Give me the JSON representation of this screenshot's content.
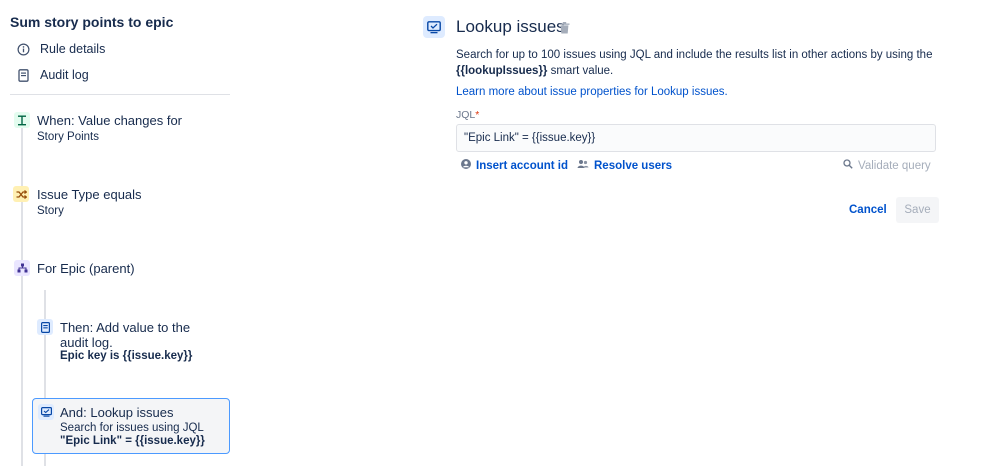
{
  "sidebar": {
    "rule_title": "Sum story points to epic",
    "menu": [
      {
        "label": "Rule details",
        "icon": "info-icon"
      },
      {
        "label": "Audit log",
        "icon": "document-icon"
      }
    ],
    "steps": {
      "trigger": {
        "title": "When: Value changes for",
        "sub": "Story Points",
        "icon": "trigger-icon",
        "color": "#E3FCEF"
      },
      "condition": {
        "title": "Issue Type equals",
        "sub": "Story",
        "icon": "shuffle-icon",
        "color": "#FFF0B3"
      },
      "branch": {
        "title": "For Epic (parent)",
        "icon": "hierarchy-icon",
        "color": "#EAE6FF"
      },
      "action_log": {
        "title_line1": "Then: Add value to the",
        "title_line2": "audit log.",
        "sub": "Epic key is {{issue.key}}",
        "icon": "document-icon",
        "color": "#DEEBFF"
      },
      "action_lookup": {
        "title": "And: Lookup issues",
        "sub_line1": "Search for issues using JQL",
        "sub_line2": "\"Epic Link\" = {{issue.key}}",
        "icon": "monitor-icon",
        "color": "#DEEBFF"
      }
    }
  },
  "panel": {
    "title": "Lookup issues",
    "description_part1": "Search for up to 100 issues using JQL and include the results list in other actions by using the",
    "description_bold": "{{lookupIssues}}",
    "description_part2": " smart value.",
    "learn_more": "Learn more about issue properties for Lookup issues.",
    "jql_label": "JQL",
    "jql_required": "*",
    "jql_value": "\"Epic Link\" = {{issue.key}}",
    "insert_account_id": "Insert account id",
    "resolve_users": "Resolve users",
    "validate_query": "Validate query",
    "cancel": "Cancel",
    "save": "Save"
  },
  "colors": {
    "accent": "#0052CC",
    "selected_border": "#4C9AFF"
  }
}
